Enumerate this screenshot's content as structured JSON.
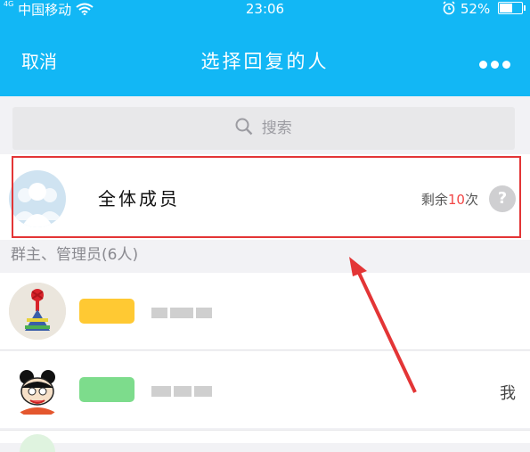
{
  "status_bar": {
    "network_type": "4G",
    "carrier": "中国移动",
    "time": "23:06",
    "battery_percent": "52%",
    "battery_level": 0.52,
    "icons": [
      "wifi-icon",
      "alarm-icon",
      "battery-icon"
    ]
  },
  "header": {
    "cancel_label": "取消",
    "title": "选择回复的人",
    "more_icon": "more-dots-icon",
    "bg_color": "#12b7f5"
  },
  "search": {
    "placeholder": "搜索",
    "icon": "search-icon"
  },
  "all_members": {
    "label": "全体成员",
    "remaining_prefix": "剩余",
    "remaining_count": "10",
    "remaining_suffix": "次",
    "help_label": "?",
    "highlight_color": "#e33536"
  },
  "section": {
    "admins_label": "群主、管理员(6人)"
  },
  "members": [
    {
      "badge_color": "#ffc933",
      "is_me": false
    },
    {
      "badge_color": "#7ddc8c",
      "is_me": true,
      "me_label": "我"
    }
  ]
}
